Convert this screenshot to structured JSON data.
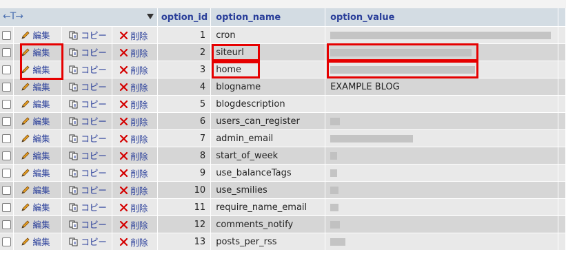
{
  "header": {
    "controls_symbol": "←T→",
    "col_option_id": "option_id",
    "col_option_name": "option_name",
    "col_option_value": "option_value"
  },
  "actions": {
    "edit_label": "編集",
    "copy_label": "コピー",
    "delete_label": "削除"
  },
  "rows": [
    {
      "option_id": "1",
      "option_name": "cron",
      "option_value": ""
    },
    {
      "option_id": "2",
      "option_name": "siteurl",
      "option_value": ""
    },
    {
      "option_id": "3",
      "option_name": "home",
      "option_value": ""
    },
    {
      "option_id": "4",
      "option_name": "blogname",
      "option_value": "EXAMPLE BLOG"
    },
    {
      "option_id": "5",
      "option_name": "blogdescription",
      "option_value": ""
    },
    {
      "option_id": "6",
      "option_name": "users_can_register",
      "option_value": ""
    },
    {
      "option_id": "7",
      "option_name": "admin_email",
      "option_value": ""
    },
    {
      "option_id": "8",
      "option_name": "start_of_week",
      "option_value": ""
    },
    {
      "option_id": "9",
      "option_name": "use_balanceTags",
      "option_value": ""
    },
    {
      "option_id": "10",
      "option_name": "use_smilies",
      "option_value": ""
    },
    {
      "option_id": "11",
      "option_name": "require_name_email",
      "option_value": ""
    },
    {
      "option_id": "12",
      "option_name": "comments_notify",
      "option_value": ""
    },
    {
      "option_id": "13",
      "option_name": "posts_per_rss",
      "option_value": ""
    }
  ],
  "colors": {
    "header_bg": "#d3dce3",
    "header_text": "#2a3f9a",
    "row_odd": "#e9e9e9",
    "row_even": "#d6d6d6",
    "highlight_box": "#e60000",
    "edit_icon": "pencil-icon",
    "copy_icon": "copy-icon",
    "delete_icon": "delete-x-icon"
  }
}
